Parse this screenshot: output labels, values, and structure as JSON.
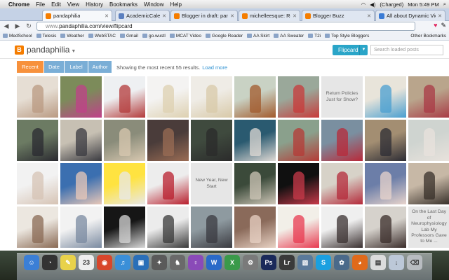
{
  "menubar": {
    "items": [
      "Chrome",
      "File",
      "Edit",
      "View",
      "History",
      "Bookmarks",
      "Window",
      "Help"
    ],
    "clock": "Mon 5:49 PM",
    "battery": "(Charged)"
  },
  "tabs": [
    {
      "label": "pandaphilia",
      "icon": "blogger-icon",
      "active": true
    },
    {
      "label": "AcademicCalendar2011-",
      "icon": "calendar-icon",
      "active": false
    },
    {
      "label": "Blogger in draft: pandap",
      "icon": "blogger-icon",
      "active": false
    },
    {
      "label": "michelleesque: Review",
      "icon": "blogger-icon",
      "active": false
    },
    {
      "label": "Blogger Buzz",
      "icon": "blogger-icon",
      "active": false
    },
    {
      "label": "All about Dynamic Views",
      "icon": "buzz-icon",
      "active": false
    }
  ],
  "omnibox": {
    "scheme": "www.",
    "url": "pandaphilia.com/view/flipcard"
  },
  "bookmarks": [
    "MedSchool",
    "Telesis",
    "Weather",
    "WebSTAC",
    "Gmail",
    "go.wustl",
    "MCAT Video",
    "Google Reader",
    "AA Skirt",
    "AA Sweater",
    "T2i",
    "Top Style Bloggers"
  ],
  "bookmarks_other": "Other Bookmarks",
  "blog": {
    "title": "pandaphilia",
    "view_button": "Flipcard",
    "search_placeholder": "Search loaded posts",
    "filters": [
      "Recent",
      "Date",
      "Label",
      "Author"
    ],
    "results_text": "Showing the most recent 55 results.",
    "load_more": "Load more"
  },
  "tiles": [
    {
      "kind": "img",
      "colors": [
        "#e6ded4",
        "#b99a82"
      ]
    },
    {
      "kind": "img",
      "colors": [
        "#7c8b5a",
        "#c0408a"
      ]
    },
    {
      "kind": "img",
      "colors": [
        "#eef0f2",
        "#b33a3a"
      ]
    },
    {
      "kind": "img",
      "colors": [
        "#f4f3f2",
        "#ddd0b0"
      ]
    },
    {
      "kind": "img",
      "colors": [
        "#efece6",
        "#d8c9a8"
      ]
    },
    {
      "kind": "img",
      "colors": [
        "#c9d2c4",
        "#a25a2c"
      ]
    },
    {
      "kind": "img",
      "colors": [
        "#9aa89a",
        "#c83a3a"
      ]
    },
    {
      "kind": "text",
      "text": "Return Policies Just for Show?"
    },
    {
      "kind": "img",
      "colors": [
        "#e8e4da",
        "#4a9fd0"
      ]
    },
    {
      "kind": "img",
      "colors": [
        "#b9a58c",
        "#a93a45"
      ]
    },
    {
      "kind": "img",
      "colors": [
        "#6c7b63",
        "#2a2a30"
      ]
    },
    {
      "kind": "img",
      "colors": [
        "#c7c0b3",
        "#3a3a40"
      ]
    },
    {
      "kind": "img",
      "colors": [
        "#8a8c7a",
        "#d8c8b0"
      ]
    },
    {
      "kind": "img",
      "colors": [
        "#4a3c3a",
        "#9a6c54"
      ]
    },
    {
      "kind": "img",
      "colors": [
        "#3f4a3e",
        "#2b2b2b"
      ]
    },
    {
      "kind": "img",
      "colors": [
        "#2a5a70",
        "#dfd9d4"
      ]
    },
    {
      "kind": "img",
      "colors": [
        "#8aa08c",
        "#b53a35"
      ]
    },
    {
      "kind": "img",
      "colors": [
        "#7a8fa0",
        "#b82a3a"
      ]
    },
    {
      "kind": "img",
      "colors": [
        "#a38e72",
        "#2c2c34"
      ]
    },
    {
      "kind": "img",
      "colors": [
        "#cfd4d0",
        "#e8e2dc"
      ]
    },
    {
      "kind": "img",
      "colors": [
        "#f2f2f2",
        "#d6c3b4"
      ]
    },
    {
      "kind": "img",
      "colors": [
        "#3b6fb0",
        "#e9c8b8"
      ]
    },
    {
      "kind": "img",
      "colors": [
        "#ffe340",
        "#e8e8e8"
      ]
    },
    {
      "kind": "img",
      "colors": [
        "#ededed",
        "#b81e2c"
      ]
    },
    {
      "kind": "text",
      "text": "New Year, New Start"
    },
    {
      "kind": "img",
      "colors": [
        "#3b4a3a",
        "#cfc7b8"
      ]
    },
    {
      "kind": "img",
      "colors": [
        "#101010",
        "#c83a4a"
      ]
    },
    {
      "kind": "img",
      "colors": [
        "#d7d2c8",
        "#b42a3a"
      ]
    },
    {
      "kind": "img",
      "colors": [
        "#6c7ea8",
        "#e8d4cc"
      ]
    },
    {
      "kind": "img",
      "colors": [
        "#c7b8a6",
        "#38302a"
      ]
    },
    {
      "kind": "img",
      "colors": [
        "#ece7e0",
        "#8a6a54"
      ]
    },
    {
      "kind": "img",
      "colors": [
        "#f2f2f2",
        "#7a8aa0"
      ]
    },
    {
      "kind": "img",
      "colors": [
        "#161616",
        "#d8d8d8"
      ]
    },
    {
      "kind": "img",
      "colors": [
        "#ececec",
        "#3a3a3a"
      ]
    },
    {
      "kind": "img",
      "colors": [
        "#8e9aa0",
        "#3a3a40"
      ]
    },
    {
      "kind": "img",
      "colors": [
        "#8a6a5a",
        "#e8d2c4"
      ]
    },
    {
      "kind": "img",
      "colors": [
        "#f2efe8",
        "#e83a50"
      ]
    },
    {
      "kind": "img",
      "colors": [
        "#efefef",
        "#3a3030"
      ]
    },
    {
      "kind": "img",
      "colors": [
        "#d6d2cc",
        "#3a2c2a"
      ]
    },
    {
      "kind": "text",
      "text": "On the Last Day of Neurophysiology Lab My Professors Gave to Me ..."
    }
  ],
  "dock": [
    {
      "name": "finder-icon",
      "color": "#3b7fd6",
      "glyph": "☺"
    },
    {
      "name": "dashboard-icon",
      "color": "#333333",
      "glyph": "◔"
    },
    {
      "name": "stickies-icon",
      "color": "#e8d24a",
      "glyph": "✎"
    },
    {
      "name": "ical-icon",
      "color": "#eeeeee",
      "glyph": "23"
    },
    {
      "name": "chrome-icon",
      "color": "#d8462b",
      "glyph": "◉"
    },
    {
      "name": "itunes-icon",
      "color": "#3a8fd8",
      "glyph": "♫"
    },
    {
      "name": "preview-icon",
      "color": "#2a6fb8",
      "glyph": "▣"
    },
    {
      "name": "app-icon",
      "color": "#5a5a5a",
      "glyph": "✦"
    },
    {
      "name": "chess-icon",
      "color": "#6a6a6a",
      "glyph": "♞"
    },
    {
      "name": "pidgin-icon",
      "color": "#8a4ab8",
      "glyph": "♀"
    },
    {
      "name": "word-icon",
      "color": "#2a6ac8",
      "glyph": "W"
    },
    {
      "name": "excel-icon",
      "color": "#3a9a4a",
      "glyph": "X"
    },
    {
      "name": "system-prefs-icon",
      "color": "#7a7a7a",
      "glyph": "⚙"
    },
    {
      "name": "photoshop-icon",
      "color": "#1a2a5a",
      "glyph": "Ps"
    },
    {
      "name": "lightroom-icon",
      "color": "#3a3a3a",
      "glyph": "Lr"
    },
    {
      "name": "photo-icon",
      "color": "#5a7a9a",
      "glyph": "▧"
    },
    {
      "name": "skype-icon",
      "color": "#1aa0e0",
      "glyph": "S"
    },
    {
      "name": "network-icon",
      "color": "#4a6a8a",
      "glyph": "✿"
    },
    {
      "name": "firefox-icon",
      "color": "#e06a1a",
      "glyph": "◕"
    },
    {
      "name": "documents-icon",
      "color": "#dcdcdc",
      "glyph": "▤"
    },
    {
      "name": "downloads-icon",
      "color": "#bcc8d8",
      "glyph": "↓"
    },
    {
      "name": "trash-icon",
      "color": "#b8bcc0",
      "glyph": "⌫"
    }
  ]
}
